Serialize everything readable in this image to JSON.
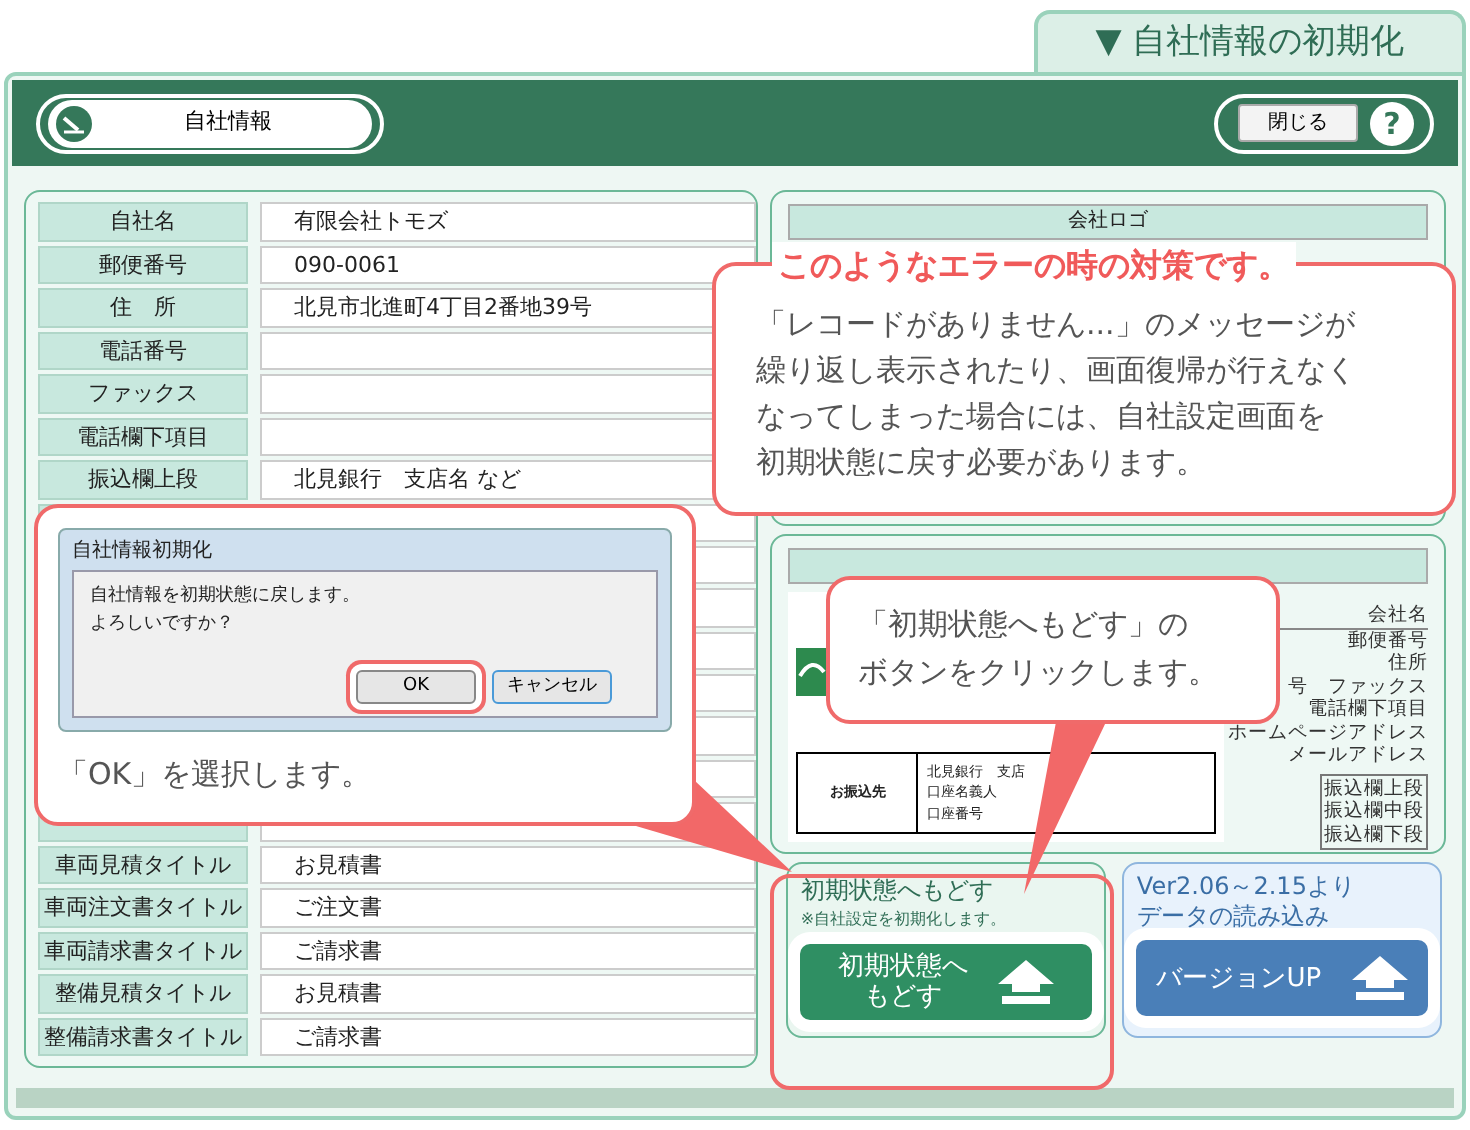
{
  "page_tab": {
    "title": "▼ 自社情報の初期化"
  },
  "toolbar": {
    "section_button": "自社情報",
    "close_button": "閉じる",
    "help_button": "?"
  },
  "form": {
    "rows_top": [
      {
        "label": "自社名",
        "value": "有限会社トモズ"
      },
      {
        "label": "郵便番号",
        "value": "090-0061"
      },
      {
        "label": "住　所",
        "value": "北見市北進町4丁目2番地39号"
      },
      {
        "label": "電話番号"
      },
      {
        "label": "ファックス"
      },
      {
        "label": "電話欄下項目"
      },
      {
        "label": "振込欄上段",
        "value": "北見銀行　支店名 など"
      }
    ],
    "rows_bottom": [
      {
        "label": "車両見積タイトル",
        "value": "お見積書"
      },
      {
        "label": "車両注文書タイトル",
        "value": "ご注文書"
      },
      {
        "label": "車両請求書タイトル",
        "value": "ご請求書"
      },
      {
        "label": "整備見積タイトル",
        "value": "お見積書"
      },
      {
        "label": "整備請求書タイトル",
        "value": "ご請求書"
      }
    ]
  },
  "logo_panel": {
    "title": "会社ロゴ"
  },
  "preview": {
    "labels": [
      "会社名",
      "郵便番号",
      "住所",
      "号　ファックス",
      "電話欄下項目",
      "ホームページアドレス",
      "メールアドレス"
    ],
    "bank_labels": [
      "振込欄上段",
      "振込欄中段",
      "振込欄下段"
    ],
    "remit": {
      "title": "お振込先",
      "lines": [
        "北見銀行　支店",
        "口座名義人",
        "口座番号"
      ]
    }
  },
  "reset_panel": {
    "title": "初期状態へもどす",
    "note": "※自社設定を初期化します。",
    "button_lines": [
      "初期状態へ",
      "もどす"
    ],
    "highlighted": true
  },
  "upgrade_panel": {
    "title_lines": [
      "Ver2.06～2.15より",
      "データの読み込み"
    ],
    "button": "バージョンUP"
  },
  "callouts": [
    {
      "kind": "error",
      "title": "このようなエラーの時の対策です。",
      "text_lines": [
        "「レコードがありません...」のメッセージが",
        "繰り返し表示されたり、画面復帰が行えなく",
        "なってしまった場合には、自社設定画面を",
        "初期状態に戻す必要があります。"
      ]
    },
    {
      "kind": "dialog",
      "title": "自社情報初期化",
      "message_lines": [
        "自社情報を初期状態に戻します。",
        "よろしいですか？"
      ],
      "buttons": [
        {
          "label": "OK",
          "highlighted": true
        },
        {
          "label": "キャンセル",
          "highlighted": false
        }
      ],
      "text": "「OK」を選択します。"
    },
    {
      "kind": "hint",
      "text_lines": [
        "「初期状態へもどす」の",
        "ボタンをクリックします。"
      ]
    }
  ]
}
